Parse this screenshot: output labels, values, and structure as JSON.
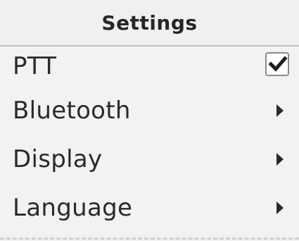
{
  "header": {
    "title": "Settings"
  },
  "menu": {
    "items": [
      {
        "label": "PTT",
        "control": "checkbox",
        "checked": true
      },
      {
        "label": "Bluetooth",
        "control": "submenu-arrow"
      },
      {
        "label": "Display",
        "control": "submenu-arrow"
      },
      {
        "label": "Language",
        "control": "submenu-arrow"
      }
    ]
  }
}
